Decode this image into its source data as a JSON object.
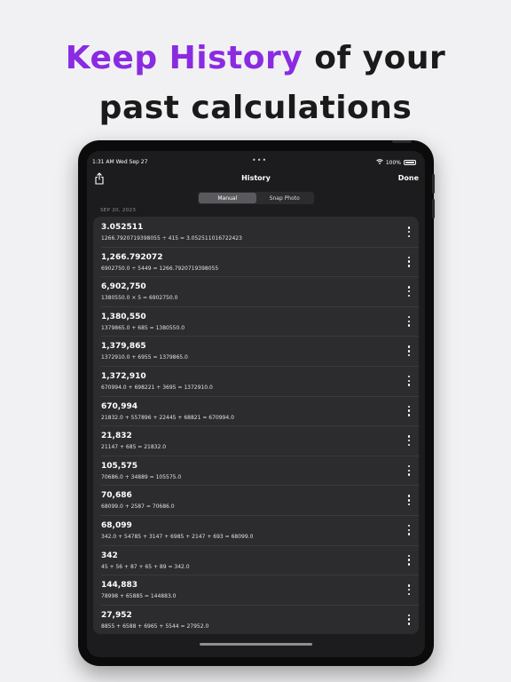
{
  "headline": {
    "accent": "Keep History",
    "line1_rest": " of your",
    "line2": "past calculations"
  },
  "status_bar": {
    "time": "1:31 AM   Wed Sep 27",
    "battery": "100%"
  },
  "nav": {
    "title": "History",
    "done_label": "Done"
  },
  "segments": [
    {
      "label": "Manual",
      "selected": true
    },
    {
      "label": "Snap Photo",
      "selected": false
    }
  ],
  "date_header": "SEP 20, 2023",
  "history": [
    {
      "result": "3.052511",
      "expr": "1266.7920719398055 ÷ 415 = 3.052511016722423"
    },
    {
      "result": "1,266.792072",
      "expr": "6902750.0 ÷ 5449 = 1266.7920719398055"
    },
    {
      "result": "6,902,750",
      "expr": "1380550.0 × 5 = 6902750.0"
    },
    {
      "result": "1,380,550",
      "expr": "1379865.0 + 685 = 1380550.0"
    },
    {
      "result": "1,379,865",
      "expr": "1372910.0 + 6955 = 1379865.0"
    },
    {
      "result": "1,372,910",
      "expr": "670994.0 + 698221 + 3695 = 1372910.0"
    },
    {
      "result": "670,994",
      "expr": "21832.0 + 557896 + 22445 + 68821 = 670994.0"
    },
    {
      "result": "21,832",
      "expr": "21147 + 685 = 21832.0"
    },
    {
      "result": "105,575",
      "expr": "70686.0 + 34889 = 105575.0"
    },
    {
      "result": "70,686",
      "expr": "68099.0 + 2587 = 70686.0"
    },
    {
      "result": "68,099",
      "expr": "342.0 + 54785 + 3147 + 6985 + 2147 + 693 = 68099.0"
    },
    {
      "result": "342",
      "expr": "45 + 56 + 87 + 65 + 89 = 342.0"
    },
    {
      "result": "144,883",
      "expr": "78998 + 65885 = 144883.0"
    },
    {
      "result": "27,952",
      "expr": "8855 + 6588 + 6965 + 5544 = 27952.0"
    }
  ],
  "colors": {
    "accent": "#8a2be2",
    "background": "#f1f1f3",
    "screen": "#1c1c1e",
    "list": "#2c2c2e"
  }
}
